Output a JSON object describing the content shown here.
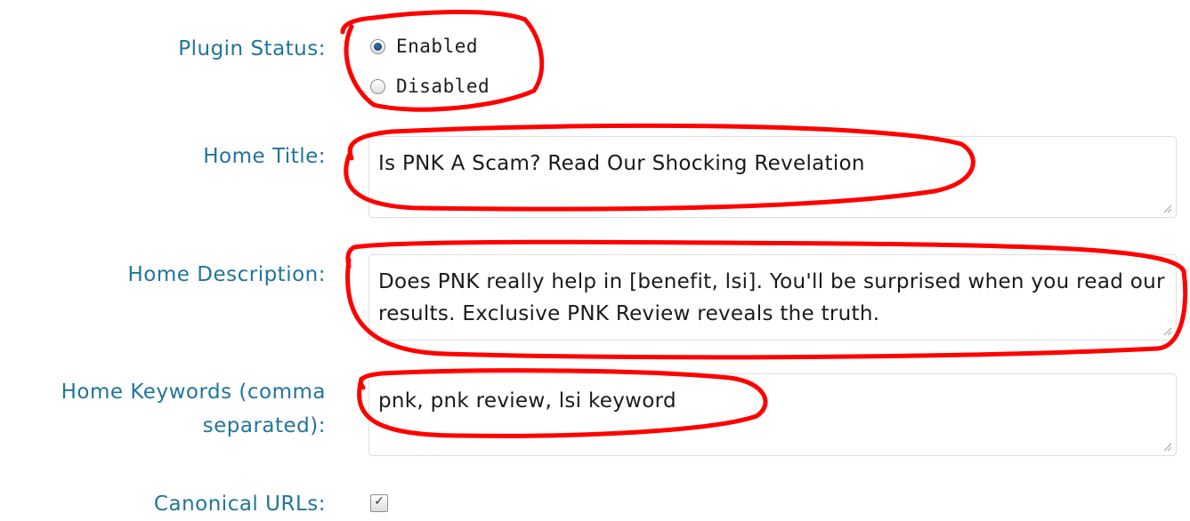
{
  "form": {
    "plugin_status": {
      "label": "Plugin Status:",
      "options": [
        "Enabled",
        "Disabled"
      ],
      "selected": "Enabled"
    },
    "home_title": {
      "label": "Home Title:",
      "value": "Is PNK A Scam? Read Our Shocking Revelation"
    },
    "home_description": {
      "label": "Home Description:",
      "value": "Does PNK really help in [benefit, lsi]. You'll be surprised when you read our results. Exclusive PNK Review reveals the truth."
    },
    "home_keywords": {
      "label_line1": "Home Keywords (comma",
      "label_line2": "separated):",
      "value": "pnk, pnk review, lsi keyword"
    },
    "canonical_urls": {
      "label": "Canonical URLs:",
      "checked": true
    }
  },
  "colors": {
    "label": "#21759b",
    "annotation": "#ff0000",
    "text": "#1a1a1a",
    "field_border": "#dfdfdf"
  },
  "icons": [
    "radio-checked-icon",
    "radio-unchecked-icon",
    "resize-grip-icon",
    "checkbox-icon"
  ]
}
